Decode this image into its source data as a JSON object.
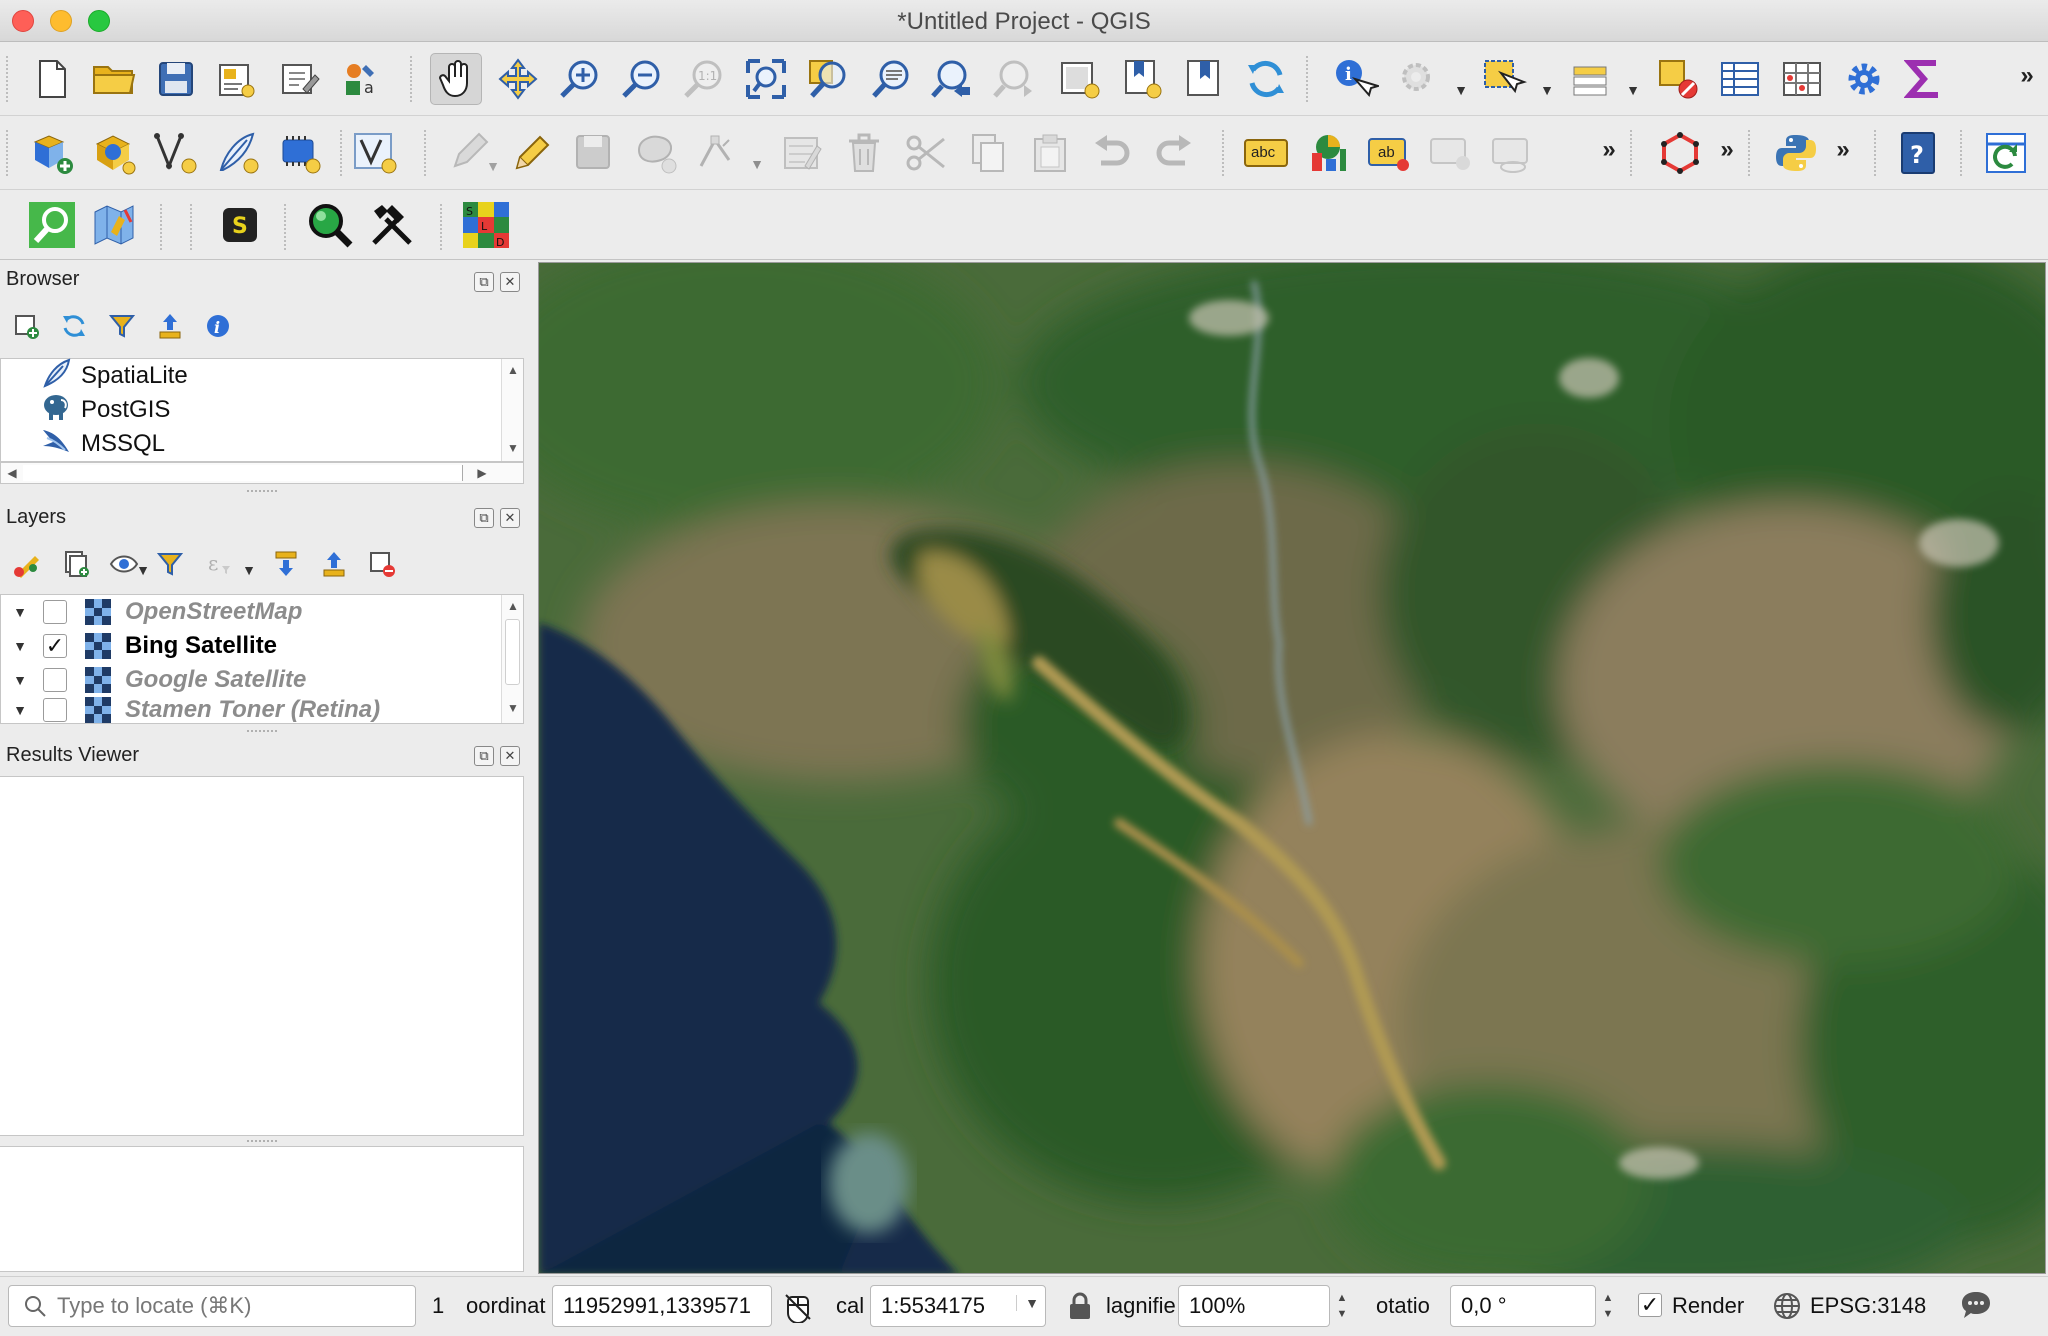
{
  "window": {
    "title": "*Untitled Project - QGIS"
  },
  "toolbar": {
    "overflow": "»",
    "label_text_icon": "abc",
    "label_text_icon2": "ab"
  },
  "browser": {
    "title": "Browser",
    "items": [
      {
        "label": "SpatiaLite",
        "icon": "feather-icon"
      },
      {
        "label": "PostGIS",
        "icon": "elephant-icon"
      },
      {
        "label": "MSSQL",
        "icon": "mssql-icon"
      }
    ]
  },
  "layers": {
    "title": "Layers",
    "items": [
      {
        "name": "OpenStreetMap",
        "checked": false,
        "check_mark": ""
      },
      {
        "name": "Bing Satellite",
        "checked": true,
        "check_mark": "✓"
      },
      {
        "name": "Google Satellite",
        "checked": false,
        "check_mark": ""
      },
      {
        "name": "Stamen Toner (Retina)",
        "checked": false,
        "check_mark": ""
      }
    ]
  },
  "results_viewer": {
    "title": "Results Viewer"
  },
  "statusbar": {
    "locator_placeholder": "Type to locate (⌘K)",
    "messages_label": "1",
    "coordinate_label": "oordinat",
    "coordinate_value": "11952991,1339571",
    "scale_label": "cal",
    "scale_value": "1:5534175",
    "magnifier_label": "lagnifie",
    "magnifier_value": "100%",
    "rotation_label": "otatio",
    "rotation_value": "0,0 °",
    "render_label": "Render",
    "render_checked": true,
    "render_check_mark": "✓",
    "crs_label": "EPSG:3148"
  },
  "colors": {
    "toolbar_bg": "#ececec",
    "accent_blue": "#2f6fd6",
    "map_water": "#142c4a",
    "map_forest": "#2f5e2a"
  }
}
